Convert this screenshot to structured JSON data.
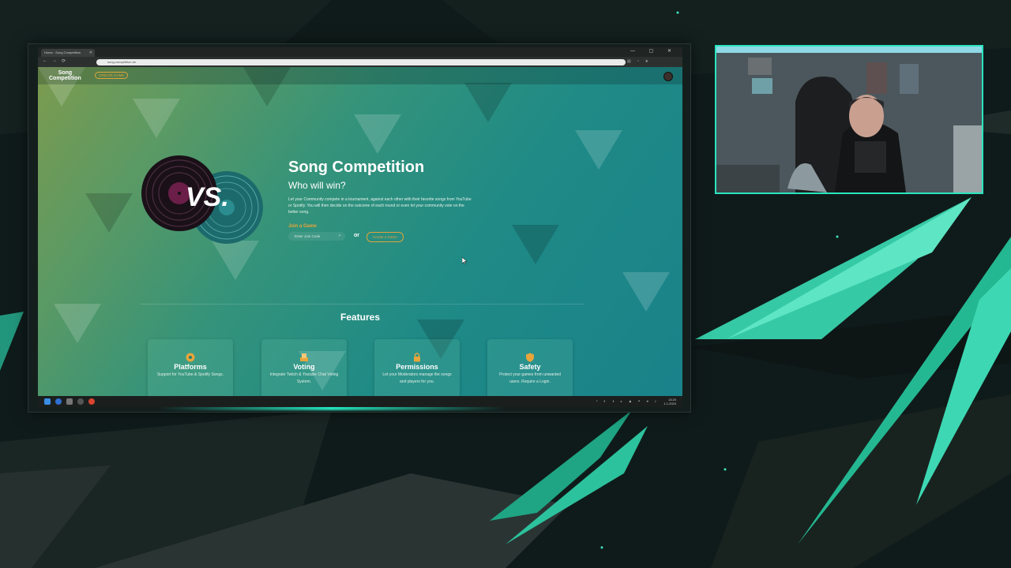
{
  "browser": {
    "tab_title": "Home - Song Competition",
    "url": "song-competition.de",
    "window_controls": "— ▢ ✕"
  },
  "site": {
    "logo_line1": "Song",
    "logo_line2": "Competition",
    "create_game_button": "CREATE GAME"
  },
  "hero": {
    "vs_text": "VS.",
    "title": "Song Competition",
    "subtitle": "Who will win?",
    "description": "Let your Community compete in a tournament, against each other with their favorite songs from YouTube or Spotify. You will then decide on the outcome of each round or even let your community vote on the better song.",
    "join_label": "Join a Game",
    "join_placeholder": "Enter Join Code",
    "join_go": "›",
    "or_text": "or",
    "create_game_button": "Create a Game"
  },
  "features": {
    "title": "Features",
    "cards": [
      {
        "title": "Platforms",
        "desc": "Support for YouTube & Spotify Songs.",
        "icon": "vinyl-icon"
      },
      {
        "title": "Voting",
        "desc": "Integrate Twitch & Youtube Chat Voting System.",
        "icon": "ballot-icon"
      },
      {
        "title": "Permissions",
        "desc": "Let your Moderators manage the songs and players for you.",
        "icon": "lock-icon"
      },
      {
        "title": "Safety",
        "desc": "Protect your games from unwanted users. Require a Login.",
        "icon": "shield-icon"
      }
    ]
  },
  "taskbar": {
    "time": "13:20",
    "date": "1.1.2024"
  },
  "colors": {
    "accent_orange": "#e0a43a",
    "accent_teal": "#2ae5c0",
    "page_teal": "#1f8a86"
  }
}
